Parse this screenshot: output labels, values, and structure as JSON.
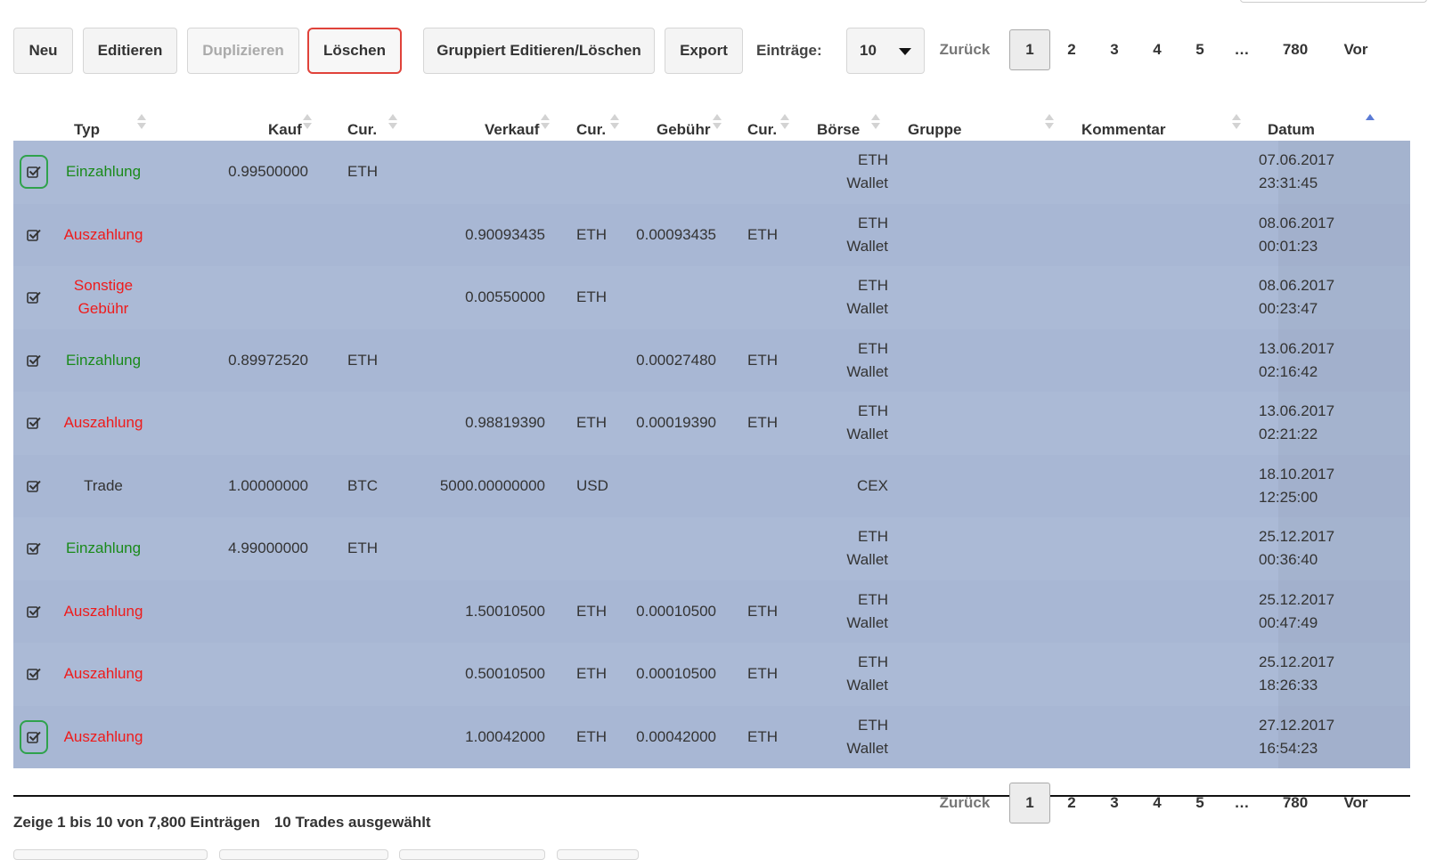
{
  "toolbar": {
    "new_label": "Neu",
    "edit_label": "Editieren",
    "duplicate_label": "Duplizieren",
    "delete_label": "Löschen",
    "group_edit_label": "Gruppiert Editieren/Löschen",
    "export_label": "Export",
    "entries_label": "Einträge:",
    "entries_value": "10"
  },
  "pagination": {
    "prev": "Zurück",
    "pages": [
      "1",
      "2",
      "3",
      "4",
      "5",
      "…",
      "780"
    ],
    "next": "Vor",
    "active": "1"
  },
  "table": {
    "columns": {
      "typ": "Typ",
      "kauf": "Kauf",
      "cur1": "Cur.",
      "verkauf": "Verkauf",
      "cur2": "Cur.",
      "gebuehr": "Gebühr",
      "cur3": "Cur.",
      "boerse": "Börse",
      "gruppe": "Gruppe",
      "kommentar": "Kommentar",
      "datum": "Datum"
    },
    "sorted_column": "datum",
    "sort_direction": "asc",
    "rows": [
      {
        "typ": "Einzahlung",
        "typ_color": "green",
        "kauf": "0.99500000",
        "cur1": "ETH",
        "verkauf": "",
        "cur2": "",
        "gebuehr": "",
        "cur3": "",
        "boerse": "ETH Wallet",
        "gruppe": "",
        "kommentar": "",
        "date": "07.06.2017",
        "time": "23:31:45",
        "checked": true,
        "highlight": true
      },
      {
        "typ": "Auszahlung",
        "typ_color": "red",
        "kauf": "",
        "cur1": "",
        "verkauf": "0.90093435",
        "cur2": "ETH",
        "gebuehr": "0.00093435",
        "cur3": "ETH",
        "boerse": "ETH Wallet",
        "gruppe": "",
        "kommentar": "",
        "date": "08.06.2017",
        "time": "00:01:23",
        "checked": true,
        "highlight": false
      },
      {
        "typ": "Sonstige Gebühr",
        "typ_color": "red",
        "kauf": "",
        "cur1": "",
        "verkauf": "0.00550000",
        "cur2": "ETH",
        "gebuehr": "",
        "cur3": "",
        "boerse": "ETH Wallet",
        "gruppe": "",
        "kommentar": "",
        "date": "08.06.2017",
        "time": "00:23:47",
        "checked": true,
        "highlight": false
      },
      {
        "typ": "Einzahlung",
        "typ_color": "green",
        "kauf": "0.89972520",
        "cur1": "ETH",
        "verkauf": "",
        "cur2": "",
        "gebuehr": "0.00027480",
        "cur3": "ETH",
        "boerse": "ETH Wallet",
        "gruppe": "",
        "kommentar": "",
        "date": "13.06.2017",
        "time": "02:16:42",
        "checked": true,
        "highlight": false
      },
      {
        "typ": "Auszahlung",
        "typ_color": "red",
        "kauf": "",
        "cur1": "",
        "verkauf": "0.98819390",
        "cur2": "ETH",
        "gebuehr": "0.00019390",
        "cur3": "ETH",
        "boerse": "ETH Wallet",
        "gruppe": "",
        "kommentar": "",
        "date": "13.06.2017",
        "time": "02:21:22",
        "checked": true,
        "highlight": false
      },
      {
        "typ": "Trade",
        "typ_color": "default",
        "kauf": "1.00000000",
        "cur1": "BTC",
        "verkauf": "5000.00000000",
        "cur2": "USD",
        "gebuehr": "",
        "cur3": "",
        "boerse": "CEX",
        "gruppe": "",
        "kommentar": "",
        "date": "18.10.2017",
        "time": "12:25:00",
        "checked": true,
        "highlight": false
      },
      {
        "typ": "Einzahlung",
        "typ_color": "green",
        "kauf": "4.99000000",
        "cur1": "ETH",
        "verkauf": "",
        "cur2": "",
        "gebuehr": "",
        "cur3": "",
        "boerse": "ETH Wallet",
        "gruppe": "",
        "kommentar": "",
        "date": "25.12.2017",
        "time": "00:36:40",
        "checked": true,
        "highlight": false
      },
      {
        "typ": "Auszahlung",
        "typ_color": "red",
        "kauf": "",
        "cur1": "",
        "verkauf": "1.50010500",
        "cur2": "ETH",
        "gebuehr": "0.00010500",
        "cur3": "ETH",
        "boerse": "ETH Wallet",
        "gruppe": "",
        "kommentar": "",
        "date": "25.12.2017",
        "time": "00:47:49",
        "checked": true,
        "highlight": false
      },
      {
        "typ": "Auszahlung",
        "typ_color": "red",
        "kauf": "",
        "cur1": "",
        "verkauf": "0.50010500",
        "cur2": "ETH",
        "gebuehr": "0.00010500",
        "cur3": "ETH",
        "boerse": "ETH Wallet",
        "gruppe": "",
        "kommentar": "",
        "date": "25.12.2017",
        "time": "18:26:33",
        "checked": true,
        "highlight": false
      },
      {
        "typ": "Auszahlung",
        "typ_color": "red",
        "kauf": "",
        "cur1": "",
        "verkauf": "1.00042000",
        "cur2": "ETH",
        "gebuehr": "0.00042000",
        "cur3": "ETH",
        "boerse": "ETH Wallet",
        "gruppe": "",
        "kommentar": "",
        "date": "27.12.2017",
        "time": "16:54:23",
        "checked": true,
        "highlight": true
      }
    ]
  },
  "footer": {
    "info": "Zeige 1 bis 10 von 7,800 Einträgen",
    "selected": "10 Trades ausgewählt"
  },
  "colors": {
    "row_bg": "#abbad6",
    "einzahlung": "#1a8a1a",
    "auszahlung": "#ee1b1b",
    "highlight_delete": "#e0423a",
    "highlight_checkbox": "#2fa24c"
  }
}
